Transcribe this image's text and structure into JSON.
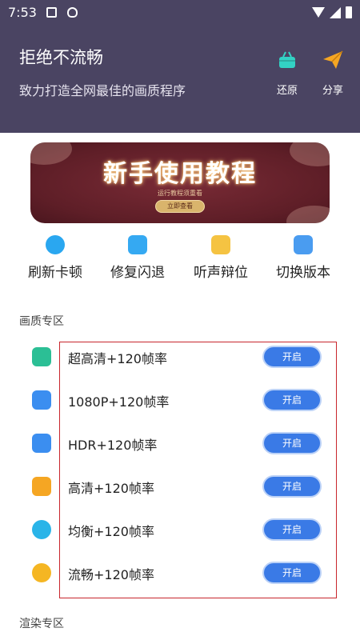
{
  "status_bar": {
    "time": "7:53"
  },
  "header": {
    "title": "拒绝不流畅",
    "subtitle": "致力打造全网最佳的画质程序",
    "restore_label": "还原",
    "share_label": "分享"
  },
  "banner": {
    "title": "新手使用教程",
    "subtitle": "运行教程须重看",
    "button_label": "立即查看"
  },
  "quick_actions": [
    {
      "label": "刷新卡顿",
      "icon": "p-circle-icon"
    },
    {
      "label": "修复闪退",
      "icon": "cloud-icon"
    },
    {
      "label": "听声辩位",
      "icon": "box-icon"
    },
    {
      "label": "切换版本",
      "icon": "doc-icon"
    }
  ],
  "quality_section": {
    "title": "画质专区",
    "items": [
      {
        "label": "超高清+120帧率",
        "button": "开启",
        "icon": "inbox-icon",
        "color": "#2bbf95"
      },
      {
        "label": "1080P+120帧率",
        "button": "开启",
        "icon": "layers-icon",
        "color": "#3b8ef0"
      },
      {
        "label": "HDR+120帧率",
        "button": "开启",
        "icon": "w-doc-icon",
        "color": "#3b8ef0"
      },
      {
        "label": "高清+120帧率",
        "button": "开启",
        "icon": "p-doc-icon",
        "color": "#f5a623"
      },
      {
        "label": "均衡+120帧率",
        "button": "开启",
        "icon": "cloud-icon",
        "color": "#2ab4e8"
      },
      {
        "label": "流畅+120帧率",
        "button": "开启",
        "icon": "g-circle-icon",
        "color": "#f5b623"
      }
    ]
  },
  "render_section": {
    "title": "渲染专区"
  },
  "colors": {
    "header_bg": "#4a4462",
    "accent": "#3a7ae6",
    "frame": "#c8262c"
  }
}
